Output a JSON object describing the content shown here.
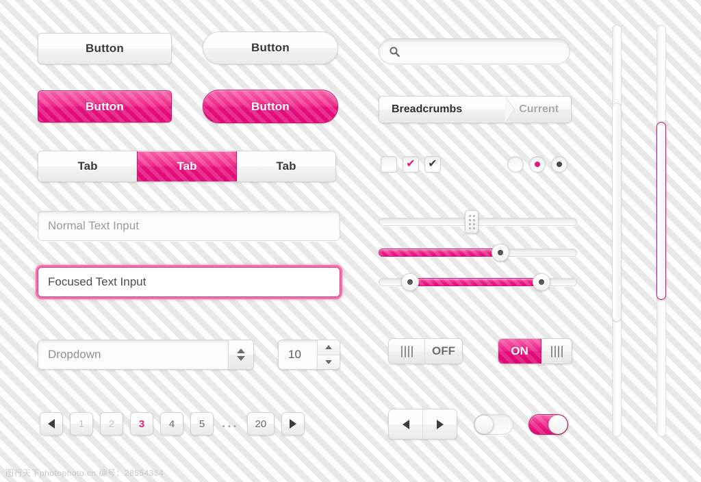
{
  "buttons": {
    "light_rect_label": "Button",
    "light_pill_label": "Button",
    "pink_rect_label": "Button",
    "pink_pill_label": "Button"
  },
  "tabs": [
    {
      "label": "Tab",
      "state": "inactive"
    },
    {
      "label": "Tab",
      "state": "active"
    },
    {
      "label": "Tab",
      "state": "inactive"
    }
  ],
  "text_inputs": {
    "normal_placeholder": "Normal Text Input",
    "focused_value": "Focused Text Input"
  },
  "dropdown": {
    "value": "Dropdown",
    "up_icon": "caret-up-icon",
    "down_icon": "caret-down-icon"
  },
  "stepper": {
    "value": "10",
    "up_icon": "caret-up-icon",
    "down_icon": "caret-down-icon"
  },
  "pagination": {
    "prev_icon": "triangle-left-icon",
    "next_icon": "triangle-right-icon",
    "ellipsis": "...",
    "pages": [
      {
        "label": "1",
        "state": "dim"
      },
      {
        "label": "2",
        "state": "dim"
      },
      {
        "label": "3",
        "state": "active"
      },
      {
        "label": "4",
        "state": "normal"
      },
      {
        "label": "5",
        "state": "normal"
      },
      {
        "label": "20",
        "state": "normal"
      }
    ]
  },
  "search": {
    "icon": "search-icon",
    "placeholder": "",
    "value": ""
  },
  "breadcrumbs": {
    "first_label": "Breadcrumbs",
    "current_label": "Current"
  },
  "checkboxes": [
    {
      "state": "unchecked",
      "mark": "",
      "color": ""
    },
    {
      "state": "checked",
      "mark": "✔",
      "color": "#e6157f"
    },
    {
      "state": "checked",
      "mark": "✔",
      "color": "#3d3d3d"
    }
  ],
  "radios": [
    {
      "state": "unselected",
      "color": ""
    },
    {
      "state": "selected",
      "color": "#e6157f"
    },
    {
      "state": "selected",
      "color": "#4a4a4a"
    }
  ],
  "sliders": [
    {
      "name": "plain-slider",
      "fill_percent": 0,
      "handle_percent": 46,
      "handle": "grip-handle"
    },
    {
      "name": "value-slider",
      "fill_percent": 60,
      "handle_percent": 60,
      "handle": "round-knob"
    },
    {
      "name": "range-slider",
      "range_start_percent": 16,
      "range_end_percent": 82,
      "handle": "round-knob"
    }
  ],
  "toggles": {
    "off": {
      "label": "OFF",
      "grip_side": "left",
      "grip_icon": "grip-lines-icon"
    },
    "on": {
      "label": "ON",
      "grip_side": "right",
      "grip_icon": "grip-lines-icon"
    }
  },
  "arrow_buttons": {
    "prev_icon": "triangle-left-icon",
    "next_icon": "triangle-right-icon"
  },
  "pill_switches": [
    {
      "state": "off",
      "knob_side": "left"
    },
    {
      "state": "on",
      "knob_side": "right"
    }
  ],
  "scrollbars": [
    {
      "name": "plain-scrollbar",
      "thumb_color": "#ffffff",
      "thumb_top_percent": 19,
      "thumb_height_percent": 53
    },
    {
      "name": "pink-scrollbar",
      "thumb_color": "#ec1f87",
      "thumb_top_percent": 24,
      "thumb_height_percent": 43
    }
  ],
  "colors": {
    "accent_pink": "#e6157f",
    "accent_pink_light": "#f65fa8",
    "text_dark": "#3a3a3a",
    "text_muted": "#9a9a9a",
    "background": "#f2f2f2"
  },
  "watermark": "图行天下photophoto.cn  编号：28554364"
}
